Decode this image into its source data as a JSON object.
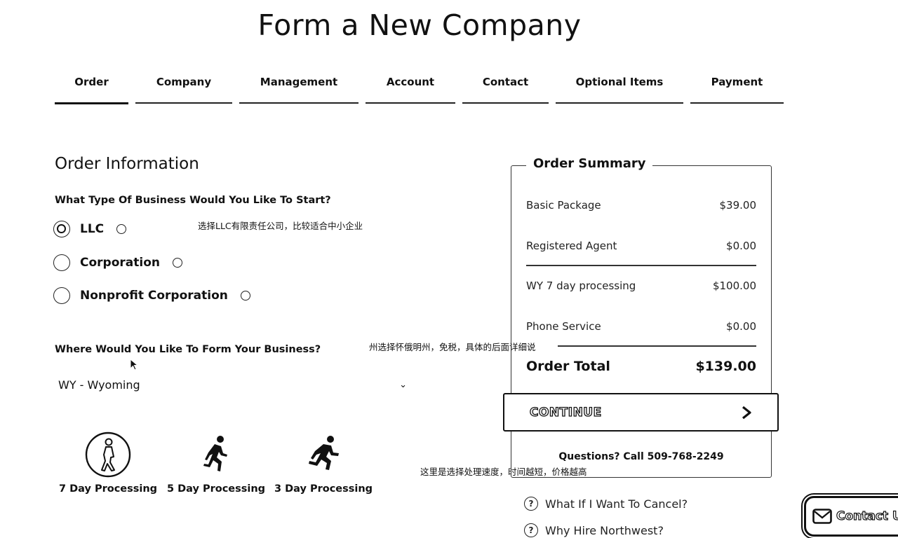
{
  "page": {
    "title": "Form a New Company"
  },
  "tabs": [
    {
      "label": "Order",
      "active": true
    },
    {
      "label": "Company"
    },
    {
      "label": "Management"
    },
    {
      "label": "Account"
    },
    {
      "label": "Contact"
    },
    {
      "label": "Optional Items"
    },
    {
      "label": "Payment"
    }
  ],
  "order_info": {
    "heading": "Order Information",
    "business_type_question": "What Type Of Business Would You Like To Start?",
    "business_types": [
      {
        "label": "LLC",
        "selected": true
      },
      {
        "label": "Corporation",
        "selected": false
      },
      {
        "label": "Nonprofit Corporation",
        "selected": false
      }
    ],
    "state_question": "Where Would You Like To Form Your Business?",
    "state_selected": "WY - Wyoming",
    "processing_options": [
      {
        "label": "7 Day Processing",
        "selected": true
      },
      {
        "label": "5 Day Processing",
        "selected": false
      },
      {
        "label": "3 Day Processing",
        "selected": false
      }
    ]
  },
  "annotations": {
    "llc_note": "选择LLC有限责任公司，比较适合中小企业",
    "state_note": "州选择怀俄明州，免税，具体的后面详细说",
    "speed_note": "这里是选择处理速度，时间越短，价格越高"
  },
  "summary": {
    "title": "Order Summary",
    "items": [
      {
        "name": "Basic Package",
        "price": "$39.00"
      },
      {
        "name": "Registered Agent",
        "price": "$0.00"
      },
      {
        "name": "WY 7 day processing",
        "price": "$100.00"
      },
      {
        "name": "Phone Service",
        "price": "$0.00"
      }
    ],
    "total_label": "Order Total",
    "total_value": "$139.00",
    "continue_label": "CONTINUE",
    "phone_text": "Questions? Call 509-768-2249"
  },
  "faq": [
    {
      "label": "What If I Want To Cancel?"
    },
    {
      "label": "Why Hire Northwest?"
    }
  ],
  "contact_button": {
    "label": "Contact U"
  },
  "icons": {
    "radio": "radio-button",
    "info": "info-circle-icon",
    "select_chevron": "chevron-down-icon",
    "walk": "walking-person-icon",
    "run": "running-person-icon",
    "continue_arrow": "chevron-right-icon",
    "help": "question-circle-icon",
    "mail": "envelope-icon"
  }
}
